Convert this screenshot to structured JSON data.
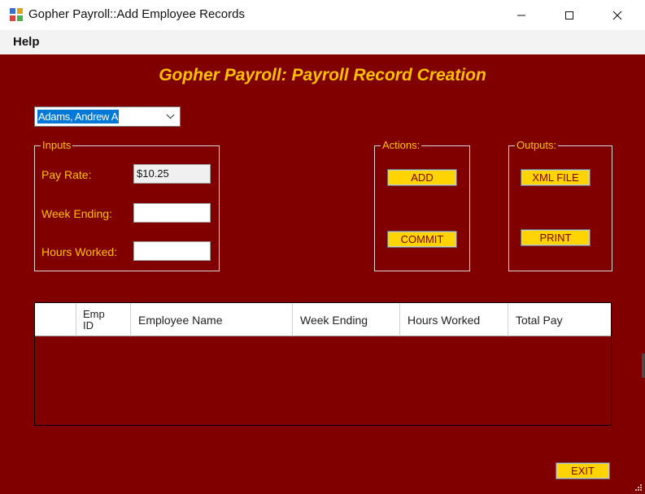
{
  "window": {
    "title": "Gopher Payroll::Add Employee Records"
  },
  "menu": {
    "help": "Help"
  },
  "header": {
    "title": "Gopher Payroll: Payroll Record Creation"
  },
  "employee_select": {
    "value": "Adams, Andrew A"
  },
  "inputs": {
    "legend": "Inputs",
    "pay_rate_label": "Pay Rate:",
    "pay_rate_value": "$10.25",
    "week_ending_label": "Week Ending:",
    "week_ending_value": "",
    "hours_worked_label": "Hours Worked:",
    "hours_worked_value": ""
  },
  "actions": {
    "legend": "Actions:",
    "add": "ADD",
    "commit": "COMMIT"
  },
  "outputs": {
    "legend": "Outputs:",
    "xml_file": "XML FILE",
    "print": "PRINT"
  },
  "grid": {
    "columns": [
      "",
      "Emp ID",
      "Employee Name",
      "Week Ending",
      "Hours Worked",
      "Total Pay"
    ],
    "rows": []
  },
  "footer": {
    "exit": "EXIT"
  },
  "colors": {
    "background": "#800000",
    "accent": "#ffc000",
    "button": "#ffd400"
  }
}
